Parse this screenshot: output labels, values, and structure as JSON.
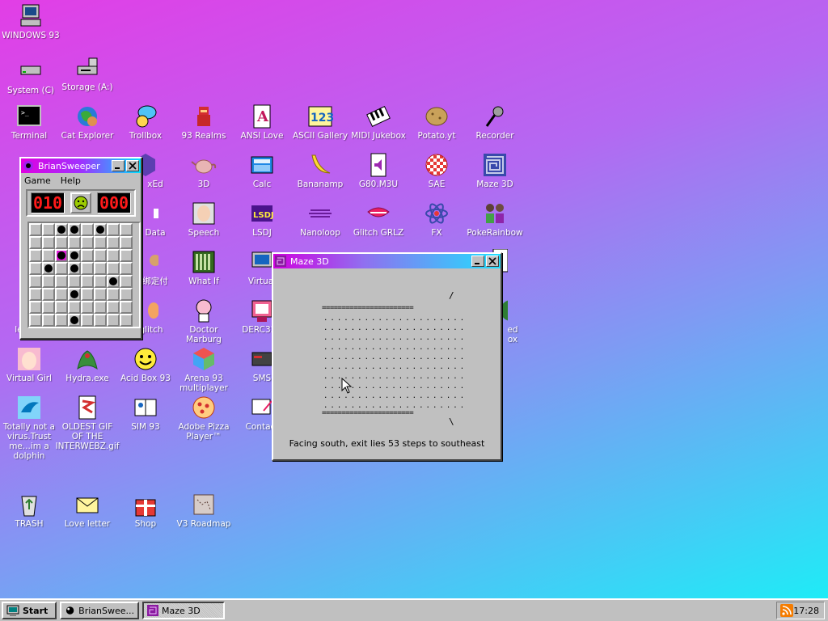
{
  "desktop": {
    "windows93": "WINDOWS 93",
    "system": "System (C)",
    "storage": "Storage (A:)",
    "terminal": "Terminal",
    "cat_explorer": "Cat Explorer",
    "trollbox": "Trollbox",
    "realms": "93 Realms",
    "ansi_love": "ANSI Love",
    "ascii_gallery": "ASCII Gallery",
    "midi_jukebox": "MIDI Jukebox",
    "potato": "Potato.yt",
    "recorder": "Recorder",
    "hexed_partial": "xEd",
    "threed": "3D",
    "calc": "Calc",
    "bananamp": "Bananamp",
    "g80": "G80.M3U",
    "sae": "SAE",
    "maze3d": "Maze 3D",
    "data_partial": "Data",
    "speech": "Speech",
    "lsdj": "LSDJ",
    "nanoloop": "Nanoloop",
    "glitch_grlz": "Glitch GRLZ",
    "fx": "FX",
    "pokerainbow": "PokeRainbow",
    "partial_kanji": "绑定付",
    "what_if": "What If",
    "virtual_partial": "Virtual",
    "glitch_partial": "glitch",
    "doctor_marburg": "Doctor Marburg",
    "derc32": "DERC32.(",
    "ed_partial": "ed",
    "ox_partial": "ox",
    "le_partial": "le",
    "virtual_girl": "Virtual Girl",
    "hydra": "Hydra.exe",
    "acid_box": "Acid Box 93",
    "arena93": "Arena 93 multiplayer",
    "sms": "SMS",
    "dolphin": "Totally not a virus.Trust me...im a dolphin",
    "oldest_gif": "OLDEST GIF OF THE INTERWEBZ.gif",
    "sim93": "SIM 93",
    "pizza": "Adobe Pizza Player™",
    "contact": "Contact",
    "trash": "TRASH",
    "love_letter": "Love letter",
    "shop": "Shop",
    "roadmap": "V3 Roadmap"
  },
  "brian": {
    "title": "BrianSweeper",
    "menu": [
      "Game",
      "Help"
    ],
    "mines_counter": "010",
    "timer": "000",
    "face": "sad-face-icon"
  },
  "maze": {
    "title": "Maze 3D",
    "top_slash": "/",
    "wall": "=======================",
    "dots": ". . . . . . . . . . . . . . . . . . . . .",
    "bottom_slash": "\\",
    "status": "Facing south, exit lies 53 steps to southeast"
  },
  "taskbar": {
    "start": "Start",
    "item1": "BrianSwee...",
    "item2": "Maze 3D",
    "clock": "17:28"
  },
  "colors": {
    "titlebar_start": "#e000e0",
    "titlebar_end": "#00e0ff",
    "window_bg": "#c0c0c0",
    "lcd_red": "#ff1a1a"
  }
}
